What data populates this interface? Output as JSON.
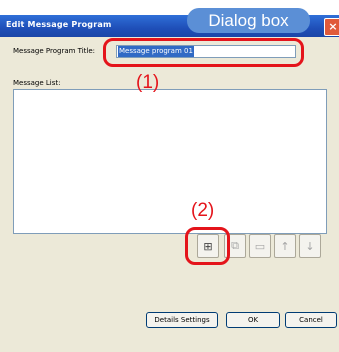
{
  "window": {
    "title": "Edit Message Program",
    "close_label": "×"
  },
  "form": {
    "program_title_label": "Message Program Title:",
    "program_title_value": "Message program 01",
    "message_list_label": "Message List:"
  },
  "toolbar": {
    "buttons": [
      {
        "name": "add",
        "icon": "add-message-icon",
        "symbol": "⊞",
        "enabled": true
      },
      {
        "name": "copy",
        "icon": "copy-icon",
        "symbol": "⧉",
        "enabled": false
      },
      {
        "name": "paste",
        "icon": "paste-icon",
        "symbol": "▭",
        "enabled": false
      },
      {
        "name": "move-up",
        "icon": "arrow-up-icon",
        "symbol": "↑",
        "enabled": false
      },
      {
        "name": "move-down",
        "icon": "arrow-down-icon",
        "symbol": "↓",
        "enabled": false
      }
    ]
  },
  "buttons": {
    "details_settings": "Details Settings",
    "ok": "OK",
    "cancel": "Cancel"
  },
  "annotations": {
    "callout": "Dialog box",
    "marker1": "(1)",
    "marker2": "(2)",
    "color": "#e4141b",
    "callout_color": "#5b8fd6"
  }
}
